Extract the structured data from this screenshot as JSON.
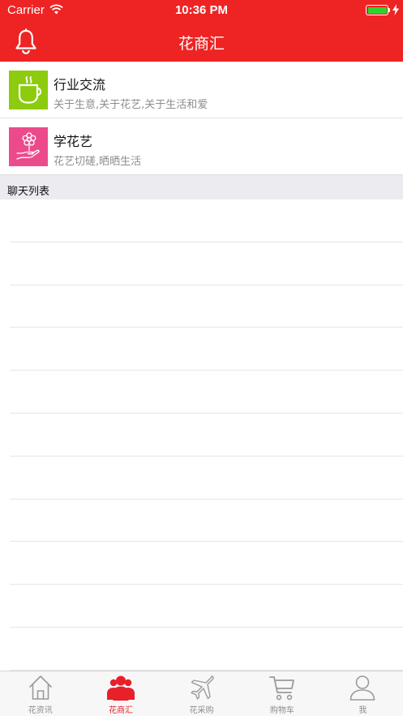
{
  "status_bar": {
    "carrier": "Carrier",
    "time": "10:36 PM",
    "battery_level": 1.0
  },
  "nav": {
    "title": "花商汇"
  },
  "features": [
    {
      "title": "行业交流",
      "subtitle": "关于生意,关于花艺,关于生活和爱",
      "icon": "coffee-cup-icon",
      "color": "#8ccb0e"
    },
    {
      "title": "学花艺",
      "subtitle": "花艺切磋,晒晒生活",
      "icon": "flower-hand-icon",
      "color": "#ec4b8b"
    }
  ],
  "section": {
    "title": "聊天列表"
  },
  "chat_list": {
    "rows": 11
  },
  "tabs": [
    {
      "label": "花资讯",
      "icon": "home-icon",
      "active": false
    },
    {
      "label": "花商汇",
      "icon": "people-icon",
      "active": true
    },
    {
      "label": "花采购",
      "icon": "airplane-icon",
      "active": false
    },
    {
      "label": "购物车",
      "icon": "cart-icon",
      "active": false
    },
    {
      "label": "我",
      "icon": "user-icon",
      "active": false
    }
  ],
  "colors": {
    "accent": "#ee2424",
    "active_tab": "#e8202a",
    "inactive_tab": "#8e8e8e"
  }
}
